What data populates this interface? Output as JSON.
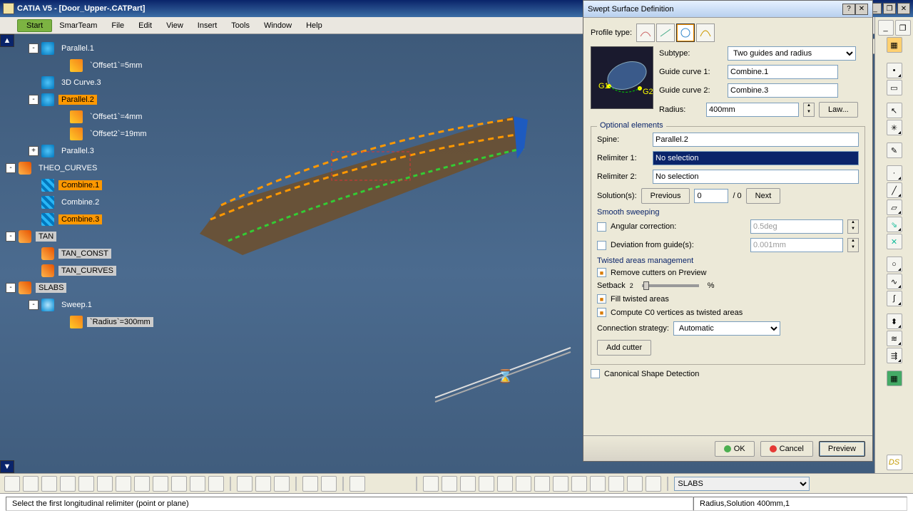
{
  "app": {
    "title": "CATIA V5 - [Door_Upper-.CATPart]"
  },
  "menu": {
    "start": "Start",
    "smarteam": "SmarTeam",
    "file": "File",
    "edit": "Edit",
    "view": "View",
    "insert": "Insert",
    "tools": "Tools",
    "window": "Window",
    "help": "Help"
  },
  "tree": {
    "nodes": [
      {
        "level": 1,
        "exp": "-",
        "icon": "curve",
        "label": "Parallel.1",
        "sel": false
      },
      {
        "level": 2,
        "exp": "",
        "icon": "offset",
        "label": "`Offset1`=5mm",
        "sel": false
      },
      {
        "level": 1,
        "exp": "",
        "icon": "curve",
        "label": "3D Curve.3",
        "sel": false,
        "curveicon": true
      },
      {
        "level": 1,
        "exp": "-",
        "icon": "curve",
        "label": "Parallel.2",
        "sel": true
      },
      {
        "level": 2,
        "exp": "",
        "icon": "offset",
        "label": "`Offset1`=4mm",
        "sel": false
      },
      {
        "level": 2,
        "exp": "",
        "icon": "offset",
        "label": "`Offset2`=19mm",
        "sel": false
      },
      {
        "level": 1,
        "exp": "+",
        "icon": "curve",
        "label": "Parallel.3",
        "sel": false
      },
      {
        "level": 0,
        "exp": "-",
        "icon": "geoset",
        "label": "THEO_CURVES",
        "sel": false
      },
      {
        "level": 1,
        "exp": "",
        "icon": "combine",
        "label": "Combine.1",
        "sel": true
      },
      {
        "level": 1,
        "exp": "",
        "icon": "combine",
        "label": "Combine.2",
        "sel": false
      },
      {
        "level": 1,
        "exp": "",
        "icon": "combine",
        "label": "Combine.3",
        "sel": true
      },
      {
        "level": 0,
        "exp": "-",
        "icon": "geoset",
        "label": "TAN",
        "sel": false,
        "gray": true
      },
      {
        "level": 1,
        "exp": "",
        "icon": "geoset",
        "label": "TAN_CONST",
        "sel": false,
        "gray": true
      },
      {
        "level": 1,
        "exp": "",
        "icon": "geoset",
        "label": "TAN_CURVES",
        "sel": false,
        "gray": true
      },
      {
        "level": 0,
        "exp": "-",
        "icon": "geoset",
        "label": "SLABS",
        "sel": false,
        "gray": true
      },
      {
        "level": 1,
        "exp": "-",
        "icon": "sweep",
        "label": "Sweep.1",
        "sel": false
      },
      {
        "level": 2,
        "exp": "",
        "icon": "offset",
        "label": "`Radius`=300mm",
        "sel": false,
        "gray": true
      }
    ]
  },
  "dialog": {
    "title": "Swept Surface Definition",
    "profile_label": "Profile type:",
    "subtype_label": "Subtype:",
    "subtype_value": "Two guides and radius",
    "gc1_label": "Guide curve 1:",
    "gc1_value": "Combine.1",
    "gc2_label": "Guide curve 2:",
    "gc2_value": "Combine.3",
    "radius_label": "Radius:",
    "radius_value": "400mm",
    "law_btn": "Law...",
    "optional_title": "Optional elements",
    "spine_label": "Spine:",
    "spine_value": "Parallel.2",
    "relim1_label": "Relimiter 1:",
    "relim1_value": "No selection",
    "relim2_label": "Relimiter 2:",
    "relim2_value": "No selection",
    "solutions_label": "Solution(s):",
    "prev_btn": "Previous",
    "sol_index": "0",
    "sol_total": "/ 0",
    "next_btn": "Next",
    "smooth_title": "Smooth sweeping",
    "angcorr_label": "Angular correction:",
    "angcorr_value": "0.5deg",
    "devguide_label": "Deviation from guide(s):",
    "devguide_value": "0.001mm",
    "twisted_title": "Twisted areas management",
    "removecut_label": "Remove cutters on Preview",
    "setback_label": "Setback",
    "setback_num": "2",
    "setback_pct": "%",
    "filltwist_label": "Fill twisted areas",
    "computeC0_label": "Compute C0 vertices as twisted areas",
    "conn_label": "Connection strategy:",
    "conn_value": "Automatic",
    "addcutter_btn": "Add cutter",
    "canonical_label": "Canonical Shape Detection",
    "ok": "OK",
    "cancel": "Cancel",
    "preview": "Preview"
  },
  "bottom": {
    "combo": "SLABS"
  },
  "status": {
    "left": "Select the first longitudinal relimiter (point or plane)",
    "right": "Radius,Solution    400mm,1"
  }
}
